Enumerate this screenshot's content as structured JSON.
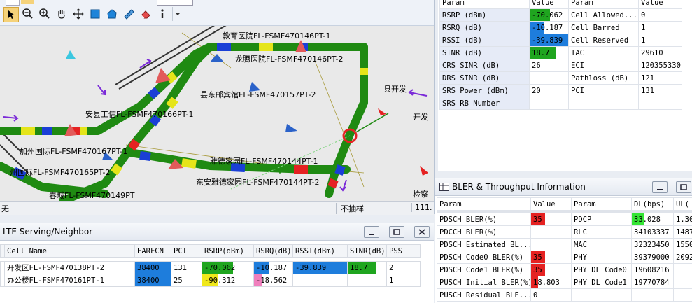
{
  "map_status": {
    "left_text": "无",
    "sample_mode": "不抽样",
    "page": "111."
  },
  "map_labels": [
    {
      "text": "教育医院FL-FSMF470146PT-1"
    },
    {
      "text": "龙腾医院FL-FSMF470146PT-2"
    },
    {
      "text": "县东邮宾馆FL-FSMF470157PT-2"
    },
    {
      "text": "安县工信FL-FSMF470166PT-1"
    },
    {
      "text": "加州国际FL-FSMF470167PT-1"
    },
    {
      "text": "州国际FL-FSMF470165PT-2"
    },
    {
      "text": "雅德家园FL-FSMF470144PT-1"
    },
    {
      "text": "东安雅德家园FL-FSMF470144PT-2"
    },
    {
      "text": "春城FL-FSMF470149PT"
    },
    {
      "text": "县开发"
    },
    {
      "text": "开发"
    },
    {
      "text": "检察"
    }
  ],
  "lte": {
    "title": "LTE Serving/Neighbor",
    "columns": [
      "Cell Name",
      "EARFCN",
      "PCI",
      "RSRP(dBm)",
      "RSRQ(dB)",
      "RSSI(dBm)",
      "SINR(dB)",
      "PSS"
    ],
    "rows": [
      {
        "name": "开发区FL-FSMF470138PT-2",
        "earfcn": "38400",
        "pci": "131",
        "rsrp": "-70.062",
        "rsrq": "-10.187",
        "rssi": "-39.839",
        "sinr": "18.7",
        "pss": "2"
      },
      {
        "name": "办公楼FL-FSMF470161PT-1",
        "earfcn": "38400",
        "pci": "25",
        "rsrp": "-90.312",
        "rsrq": "-18.562",
        "rssi": "",
        "sinr": "",
        "pss": "1"
      }
    ]
  },
  "params": {
    "headers": [
      "Param",
      "Value",
      "Param",
      "Value"
    ],
    "rows": [
      {
        "p1": "RSRP (dBm)",
        "v1": "-70.062",
        "p2": "Cell Allowed...",
        "v2": "0"
      },
      {
        "p1": "RSRQ (dB)",
        "v1": "-10.187",
        "p2": "Cell Barred",
        "v2": "1"
      },
      {
        "p1": "RSSI (dB)",
        "v1": "-39.839",
        "p2": "Cell Reserved",
        "v2": "1"
      },
      {
        "p1": "SINR (dB)",
        "v1": "18.7",
        "p2": "TAC",
        "v2": "29610"
      },
      {
        "p1": "CRS SINR (dB)",
        "v1": "26",
        "p2": "ECI",
        "v2": "120355330"
      },
      {
        "p1": "DRS SINR (dB)",
        "v1": "",
        "p2": "Pathloss (dB)",
        "v2": "121"
      },
      {
        "p1": "SRS Power (dBm)",
        "v1": "20",
        "p2": "PCI",
        "v2": "131"
      },
      {
        "p1": "SRS RB Number",
        "v1": "",
        "p2": "",
        "v2": ""
      }
    ],
    "colors": {
      "rsrp": "#1fa51f",
      "rsrq": "#1e7ddc",
      "rssi": "#1e7ddc",
      "sinr": "#1fa51f"
    }
  },
  "bler": {
    "title": "BLER & Throughput Information",
    "headers": [
      "Param",
      "Value",
      "Param",
      "DL(bps)",
      "UL("
    ],
    "rows": [
      {
        "p1": "PDSCH BLER(%)",
        "v1": "35",
        "p2": "PDCP",
        "dl": "33.028",
        "ul": "1.30"
      },
      {
        "p1": "PDCCH BLER(%)",
        "v1": "",
        "p2": "RLC",
        "dl": "34103337",
        "ul": "1487"
      },
      {
        "p1": "PDSCH Estimated BL...",
        "v1": "",
        "p2": "MAC",
        "dl": "32323450",
        "ul": "1550"
      },
      {
        "p1": "PDSCH Code0 BLER(%)",
        "v1": "35",
        "p2": "PHY",
        "dl": "39379000",
        "ul": "2092"
      },
      {
        "p1": "PDSCH Code1 BLER(%)",
        "v1": "35",
        "p2": "PHY DL Code0",
        "dl": "19608216",
        "ul": ""
      },
      {
        "p1": "PUSCH Initial BLER(%)",
        "v1": "18.803",
        "p2": "PHY DL Code1",
        "dl": "19770784",
        "ul": ""
      },
      {
        "p1": "PUSCH Residual BLE...",
        "v1": "0",
        "p2": "",
        "dl": "",
        "ul": ""
      }
    ]
  }
}
